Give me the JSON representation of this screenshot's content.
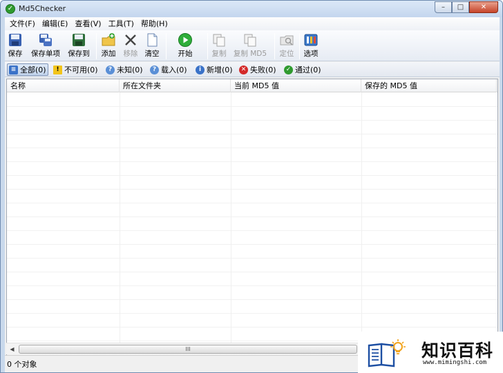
{
  "window": {
    "title": "Md5Checker",
    "minimize": "–",
    "maximize": "□",
    "close": "✕"
  },
  "menu": [
    {
      "label": "文件(F)"
    },
    {
      "label": "编辑(E)"
    },
    {
      "label": "查看(V)"
    },
    {
      "label": "工具(T)"
    },
    {
      "label": "帮助(H)"
    }
  ],
  "toolbar": {
    "save": "保存",
    "save_single": "保存单项",
    "save_to": "保存到",
    "add": "添加",
    "remove": "移除",
    "clear": "清空",
    "start": "开始",
    "copy": "复制",
    "copy_md5": "复制 MD5",
    "locate": "定位",
    "options": "选项"
  },
  "filters": [
    {
      "label": "全部(0)",
      "icon": "list-icon"
    },
    {
      "label": "不可用(0)",
      "icon": "warning-icon"
    },
    {
      "label": "未知(0)",
      "icon": "unknown-icon"
    },
    {
      "label": "载入(0)",
      "icon": "loaded-icon"
    },
    {
      "label": "新增(0)",
      "icon": "info-icon"
    },
    {
      "label": "失败(0)",
      "icon": "error-icon"
    },
    {
      "label": "通过(0)",
      "icon": "check-icon"
    }
  ],
  "columns": [
    "名称",
    "所在文件夹",
    "当前 MD5 值",
    "保存的 MD5 值"
  ],
  "scroll_grip": "III",
  "status": {
    "text": "0 个对象"
  },
  "watermark": {
    "title": "知识百科",
    "url": "www.mimingshi.com"
  },
  "colors": {
    "title_bg": "#c4d6ee",
    "accent_green": "#2f9a2f",
    "error_red": "#d42a2a",
    "warning_yellow": "#f2c419"
  }
}
